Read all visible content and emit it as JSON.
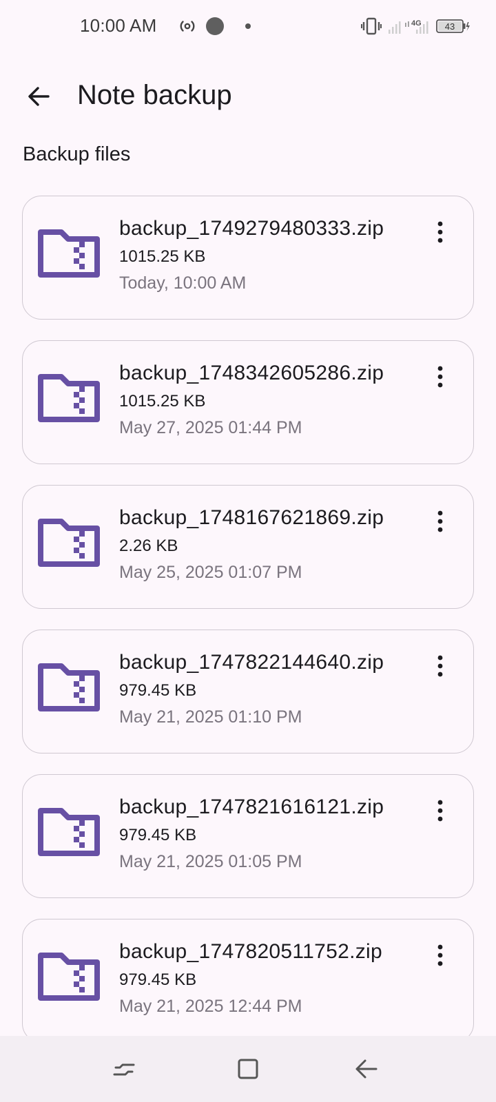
{
  "status_bar": {
    "time": "10:00 AM",
    "network": "4G",
    "battery": "43",
    "icons": [
      "hotspot-icon",
      "record-dot-icon",
      "notification-dot-icon",
      "vibrate-icon",
      "signal-icon",
      "charging-icon"
    ]
  },
  "app_bar": {
    "title": "Note backup",
    "back_icon": "arrow-back-icon"
  },
  "section": {
    "title": "Backup files"
  },
  "files": [
    {
      "name": "backup_1749279480333.zip",
      "size": "1015.25 KB",
      "date": "Today, 10:00 AM"
    },
    {
      "name": "backup_1748342605286.zip",
      "size": "1015.25 KB",
      "date": "May 27, 2025 01:44 PM"
    },
    {
      "name": "backup_1748167621869.zip",
      "size": "2.26 KB",
      "date": "May 25, 2025 01:07 PM"
    },
    {
      "name": "backup_1747822144640.zip",
      "size": "979.45 KB",
      "date": "May 21, 2025 01:10 PM"
    },
    {
      "name": "backup_1747821616121.zip",
      "size": "979.45 KB",
      "date": "May 21, 2025 01:05 PM"
    },
    {
      "name": "backup_1747820511752.zip",
      "size": "979.45 KB",
      "date": "May 21, 2025 12:44 PM"
    }
  ],
  "colors": {
    "accent": "#6750A4",
    "background": "#FDF7FC",
    "card_border": "#CFC8D1",
    "secondary_text": "#7A747E"
  },
  "nav_bar": {
    "icons": [
      "recents-icon",
      "home-icon",
      "back-icon"
    ]
  }
}
